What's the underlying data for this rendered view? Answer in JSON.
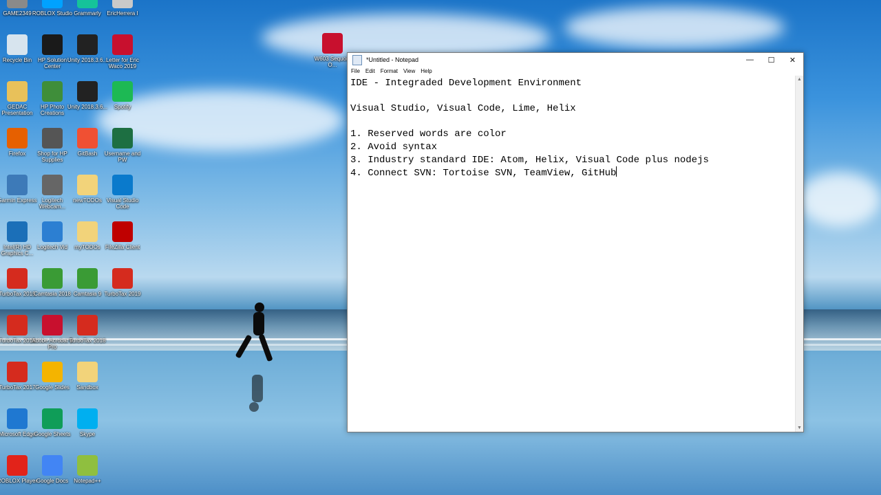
{
  "desktop": {
    "icons": [
      {
        "label": "GAME2349",
        "icon": "game-icon",
        "color": "#8a8a8a"
      },
      {
        "label": "Recycle Bin",
        "icon": "recycle-bin-icon",
        "color": "#d7e4ee"
      },
      {
        "label": "GEDAC Presentation",
        "icon": "folder-icon",
        "color": "#e8c15a"
      },
      {
        "label": "Firefox",
        "icon": "firefox-icon",
        "color": "#e66000"
      },
      {
        "label": "Garmin Express",
        "icon": "garmin-icon",
        "color": "#3d7ab8"
      },
      {
        "label": "Intel(R) HD Graphics C...",
        "icon": "intel-icon",
        "color": "#1b6fb8"
      },
      {
        "label": "TurboTax 2015",
        "icon": "turbotax-icon",
        "color": "#d52b1e"
      },
      {
        "label": "TurboTax 2016",
        "icon": "turbotax-icon",
        "color": "#d52b1e"
      },
      {
        "label": "TurboTax 2017",
        "icon": "turbotax-icon",
        "color": "#d52b1e"
      },
      {
        "label": "Microsoft Edge",
        "icon": "edge-icon",
        "color": "#1f78d1"
      },
      {
        "label": "ROBLOX Player",
        "icon": "roblox-icon",
        "color": "#e2231a"
      },
      {
        "label": "ROBLOX Studio",
        "icon": "roblox-studio-icon",
        "color": "#00a2ff"
      },
      {
        "label": "HP Solution Center",
        "icon": "hp-icon",
        "color": "#1a1a1a"
      },
      {
        "label": "HP Photo Creations",
        "icon": "photo-icon",
        "color": "#3f8e3a"
      },
      {
        "label": "Shop for HP Supplies",
        "icon": "printer-icon",
        "color": "#555555"
      },
      {
        "label": "Logitech Webcam...",
        "icon": "webcam-icon",
        "color": "#666666"
      },
      {
        "label": "Logitech Vid",
        "icon": "logitech-vid-icon",
        "color": "#2c7fd2"
      },
      {
        "label": "Camtasia 2018",
        "icon": "camtasia-icon",
        "color": "#3a9b35"
      },
      {
        "label": "Adobe Acrobat 9 Pro",
        "icon": "pdf-icon",
        "color": "#c8102e"
      },
      {
        "label": "Google Slides",
        "icon": "google-slides-icon",
        "color": "#f4b400"
      },
      {
        "label": "Google Sheets",
        "icon": "google-sheets-icon",
        "color": "#0f9d58"
      },
      {
        "label": "Google Docs",
        "icon": "google-docs-icon",
        "color": "#4285f4"
      },
      {
        "label": "Grammarly",
        "icon": "grammarly-icon",
        "color": "#15c39a"
      },
      {
        "label": "Unity 2018.3.6...",
        "icon": "unity-icon",
        "color": "#222222"
      },
      {
        "label": "Unity 2018.3.6...",
        "icon": "unity-icon",
        "color": "#222222"
      },
      {
        "label": "GitBash",
        "icon": "gitbash-icon",
        "color": "#f05033"
      },
      {
        "label": "newTODOs",
        "icon": "folder-icon",
        "color": "#f2d37a"
      },
      {
        "label": "myTODOs",
        "icon": "folder-icon",
        "color": "#f2d37a"
      },
      {
        "label": "Camtasia 9",
        "icon": "camtasia-icon",
        "color": "#3a9b35"
      },
      {
        "label": "TurboTax 2018",
        "icon": "turbotax-icon",
        "color": "#d52b1e"
      },
      {
        "label": "Sandbox",
        "icon": "folder-icon",
        "color": "#f2d37a"
      },
      {
        "label": "Skype",
        "icon": "skype-icon",
        "color": "#00aff0"
      },
      {
        "label": "Notepad++",
        "icon": "notepadpp-icon",
        "color": "#8fbf3f"
      },
      {
        "label": "EricHerrera I",
        "icon": "user-folder-icon",
        "color": "#c9c9c9"
      },
      {
        "label": "Letter for Eric Waco 2019",
        "icon": "pdf-icon",
        "color": "#c8102e"
      },
      {
        "label": "Spotify",
        "icon": "spotify-icon",
        "color": "#1db954"
      },
      {
        "label": "Username and PW",
        "icon": "excel-icon",
        "color": "#1d6f42"
      },
      {
        "label": "Visual Studio Code",
        "icon": "vscode-icon",
        "color": "#0a7acc"
      },
      {
        "label": "FileZilla Client",
        "icon": "filezilla-icon",
        "color": "#bf0000"
      },
      {
        "label": "TurboTax 2019",
        "icon": "turbotax-icon",
        "color": "#d52b1e"
      },
      {
        "label": "W603 Sequoia O...",
        "icon": "pdf-icon",
        "color": "#c8102e"
      }
    ]
  },
  "notepad": {
    "title": "*Untitled - Notepad",
    "menu": [
      "File",
      "Edit",
      "Format",
      "View",
      "Help"
    ],
    "lines": [
      "IDE - Integraded Development Environment",
      "",
      "Visual Studio, Visual Code, Lime, Helix",
      "",
      "1. Reserved words are color",
      "2. Avoid syntax",
      "3. Industry standard IDE: Atom, Helix, Visual Code plus nodejs",
      "4. Connect SVN: Tortoise SVN, TeamView, GitHub"
    ],
    "buttons": {
      "minimize": "—",
      "maximize": "☐",
      "close": "✕"
    }
  }
}
